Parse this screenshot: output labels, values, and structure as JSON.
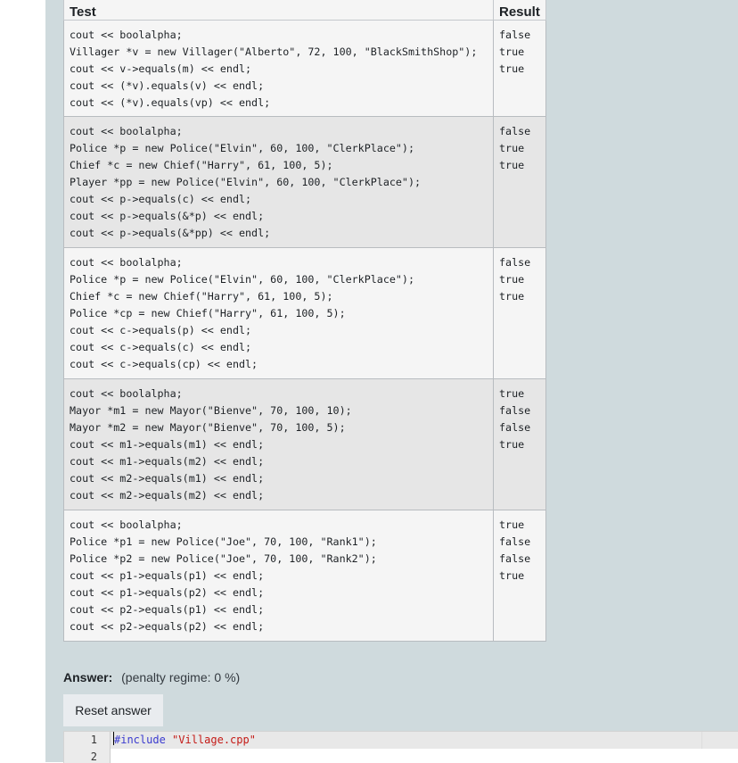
{
  "table": {
    "headers": {
      "test": "Test",
      "result": "Result"
    },
    "rows": [
      {
        "test": "cout << boolalpha;\nVillager *v = new Villager(\"Alberto\", 72, 100, \"BlackSmithShop\");\ncout << v->equals(m) << endl;\ncout << (*v).equals(v) << endl;\ncout << (*v).equals(vp) << endl;",
        "result": "false\ntrue\ntrue"
      },
      {
        "test": "cout << boolalpha;\nPolice *p = new Police(\"Elvin\", 60, 100, \"ClerkPlace\");\nChief *c = new Chief(\"Harry\", 61, 100, 5);\nPlayer *pp = new Police(\"Elvin\", 60, 100, \"ClerkPlace\");\ncout << p->equals(c) << endl;\ncout << p->equals(&*p) << endl;\ncout << p->equals(&*pp) << endl;",
        "result": "false\ntrue\ntrue"
      },
      {
        "test": "cout << boolalpha;\nPolice *p = new Police(\"Elvin\", 60, 100, \"ClerkPlace\");\nChief *c = new Chief(\"Harry\", 61, 100, 5);\nPolice *cp = new Chief(\"Harry\", 61, 100, 5);\ncout << c->equals(p) << endl;\ncout << c->equals(c) << endl;\ncout << c->equals(cp) << endl;",
        "result": "false\ntrue\ntrue"
      },
      {
        "test": "cout << boolalpha;\nMayor *m1 = new Mayor(\"Bienve\", 70, 100, 10);\nMayor *m2 = new Mayor(\"Bienve\", 70, 100, 5);\ncout << m1->equals(m1) << endl;\ncout << m1->equals(m2) << endl;\ncout << m2->equals(m1) << endl;\ncout << m2->equals(m2) << endl;",
        "result": "true\nfalse\nfalse\ntrue"
      },
      {
        "test": "cout << boolalpha;\nPolice *p1 = new Police(\"Joe\", 70, 100, \"Rank1\");\nPolice *p2 = new Police(\"Joe\", 70, 100, \"Rank2\");\ncout << p1->equals(p1) << endl;\ncout << p1->equals(p2) << endl;\ncout << p2->equals(p1) << endl;\ncout << p2->equals(p2) << endl;",
        "result": "true\nfalse\nfalse\ntrue"
      }
    ]
  },
  "answer": {
    "label": "Answer:",
    "penalty": "(penalty regime: 0 %)",
    "reset_label": "Reset answer"
  },
  "editor": {
    "line_numbers": [
      "1",
      "2"
    ],
    "line1_directive": "#include",
    "line1_string": "\"Village.cpp\""
  }
}
